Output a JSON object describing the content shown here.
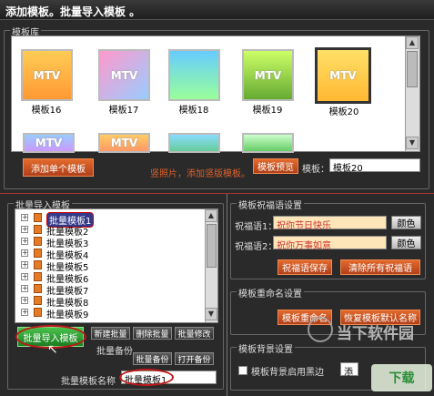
{
  "window": {
    "title": "添加模板。批量导入模板 。"
  },
  "library": {
    "group_label": "模板库",
    "thumbs_top": [
      {
        "label": "模板16",
        "art": "MTV"
      },
      {
        "label": "模板17",
        "art": "MTV"
      },
      {
        "label": "模板18",
        "art": ""
      },
      {
        "label": "模板19",
        "art": "MTV"
      },
      {
        "label": "模板20",
        "art": "MTV"
      }
    ],
    "thumbs_bottom": [
      {
        "art": "MTV"
      },
      {
        "art": "MTV"
      },
      {
        "art": ""
      },
      {
        "art": ""
      }
    ],
    "add_single_label": "添加单个模板",
    "hint_text": "竖照片，添加竖版模板。",
    "preview_label": "模板预览",
    "template_label": "模板：",
    "template_value": "模板20"
  },
  "batch": {
    "group_label": "批量导入模板",
    "items": [
      "批量模板1",
      "批量模板2",
      "批量模板3",
      "批量模板4",
      "批量模板5",
      "批量模板6",
      "批量模板7",
      "批量模板8",
      "批量模板9"
    ],
    "import_label": "批量导入模板",
    "new_label": "新建批量",
    "delete_label": "删除批量",
    "modify_label": "批量修改",
    "backup_group": "批量备份",
    "backup_label": "批量备份",
    "open_backup_label": "打开备份",
    "name_label": "批量模板名称",
    "name_value": "批量模板1"
  },
  "greeting": {
    "group_label": "模板祝福语设置",
    "line1_label": "祝福语1：",
    "line1_value": "祝你节日快乐",
    "line2_label": "祝福语2：",
    "line2_value": "祝你万事如意",
    "color_label": "颜色",
    "save_label": "祝福语保存",
    "clear_label": "清除所有祝福语"
  },
  "rename": {
    "group_label": "模板重命名设置",
    "rename_label": "模板重命名",
    "restore_label": "恢复模板默认名称"
  },
  "background": {
    "group_label": "模板背景设置",
    "checkbox_label": "模板背景启用黑边",
    "extra_label": "添"
  },
  "watermark": {
    "text": "当下软件园",
    "sub": "下载"
  },
  "colors": {
    "accent": "#c8501e",
    "title": "#ffffff",
    "panel": "#2a2a2a"
  }
}
